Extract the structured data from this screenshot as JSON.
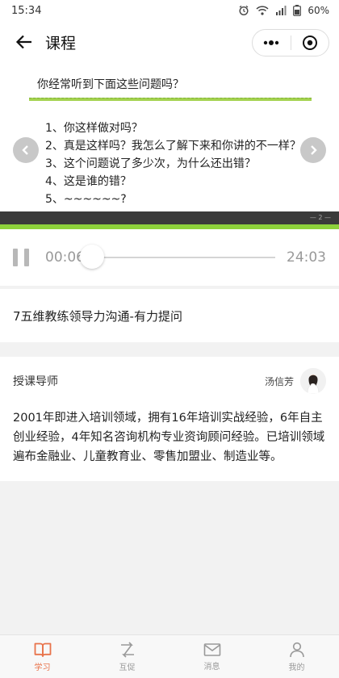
{
  "status": {
    "time": "15:34",
    "battery": "60%"
  },
  "header": {
    "title": "课程"
  },
  "slide": {
    "question": "你经常听到下面这些问题吗？",
    "items": [
      "1、你这样做对吗？",
      "2、真是这样吗？我怎么了解下来和你讲的不一样？",
      "3、这个问题说了多少次，为什么还出错？",
      "4、这是谁的错？",
      "5、~~~~~~?"
    ],
    "page_indicator": "— 2 —"
  },
  "player": {
    "current_time": "00:06",
    "total_time": "24:03",
    "progress": 0.0042
  },
  "course": {
    "title": "7五维教练领导力沟通-有力提问"
  },
  "teacher": {
    "section_label": "授课导师",
    "name": "汤信芳",
    "bio": "2001年即进入培训领域，拥有16年培训实战经验，6年自主创业经验，4年知名咨询机构专业资询顾问经验。已培训领域遍布金融业、儿童教育业、零售加盟业、制造业等。"
  },
  "tabs": [
    {
      "label": "学习",
      "icon": "book-icon",
      "active": true
    },
    {
      "label": "互促",
      "icon": "swap-icon",
      "active": false
    },
    {
      "label": "消息",
      "icon": "mail-icon",
      "active": false
    },
    {
      "label": "我的",
      "icon": "person-icon",
      "active": false
    }
  ],
  "colors": {
    "accent": "#e8734b",
    "slide_green": "#8dd13b"
  }
}
